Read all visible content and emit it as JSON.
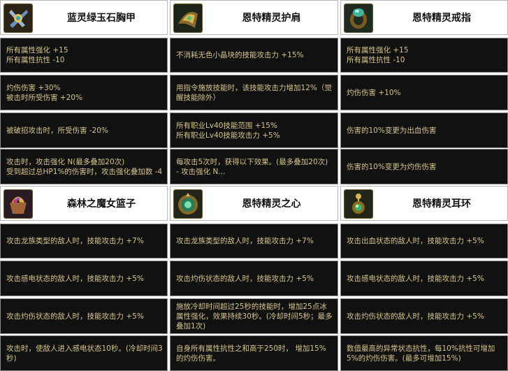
{
  "columns": [
    {
      "title": "蓝灵绿玉石胸甲",
      "icon": "chest-armor-icon",
      "rows_top": [
        [
          "所有属性强化 +15",
          "所有属性抗性 -10"
        ],
        [
          "灼伤伤害 +30%",
          "被击时所受伤害 +20%"
        ],
        [
          "被破招攻击时，所受伤害 -20%"
        ],
        [
          "攻击时，攻击强化 N(最多叠加20次)",
          "受到超过总HP1%的伤害时，攻击强化叠加数 -4"
        ]
      ]
    },
    {
      "title": "恩特精灵护肩",
      "icon": "shoulder-armor-icon",
      "rows_top": [
        [
          "不消耗无色小晶块的技能攻击力 +15%"
        ],
        [
          "用指令施放技能时，该技能攻击力增加12%（觉醒技能除外）"
        ],
        [
          "所有职业Lv40技能范围 +15%",
          "所有职业Lv40技能攻击力 +5%"
        ],
        [
          "每攻击5次时，获得以下效果。(最多叠加20次)",
          "- 攻击强化 N..."
        ]
      ]
    },
    {
      "title": "恩特精灵戒指",
      "icon": "ring-icon",
      "rows_top": [
        [
          "所有属性强化 +15",
          "所有属性抗性 -10"
        ],
        [
          "灼伤伤害 +10%"
        ],
        [
          "伤害的10%变更为出血伤害"
        ],
        [
          "伤害的10%变更为灼伤伤害"
        ]
      ]
    }
  ],
  "columns_bottom": [
    {
      "title": "森林之魔女篮子",
      "icon": "basket-icon",
      "rows": [
        [
          "攻击龙族类型的敌人时，技能攻击力 +7%"
        ],
        [
          "攻击感电状态的敌人时，技能攻击力 +5%"
        ],
        [
          "攻击灼伤状态的敌人时，技能攻击力 +5%"
        ],
        [
          "攻击时，使敌人进入感电状态10秒。(冷却时间3秒)"
        ]
      ]
    },
    {
      "title": "恩特精灵之心",
      "icon": "heart-gem-icon",
      "rows": [
        [
          "攻击龙族类型的敌人时，技能攻击力 +7%"
        ],
        [
          "攻击灼伤状态的敌人时，技能攻击力 +5%"
        ],
        [
          "施放冷却时间超过25秒的技能时，增加25点冰属性强化，效果持续30秒。(冷却时间5秒；最多叠加1次)"
        ],
        [
          "自身所有属性抗性之和高于250时， 增加15%的灼伤伤害。"
        ]
      ]
    },
    {
      "title": "恩特精灵耳环",
      "icon": "earring-icon",
      "rows": [
        [
          "攻击出血状态的敌人时，技能攻击力 +5%"
        ],
        [
          "攻击感电状态的敌人时，技能攻击力 +5%"
        ],
        [
          "攻击灼伤状态的敌人时，技能攻击力 +5%"
        ],
        [
          "数值最高的异常状态抗性，每10%抗性可增加5%的灼伤伤害。(最多可增加15%)"
        ]
      ]
    }
  ],
  "colors": {
    "cell_bg": "#111111",
    "cell_text": "#d6c58a",
    "header_bg": "#ffffff",
    "title_text": "#111111"
  }
}
